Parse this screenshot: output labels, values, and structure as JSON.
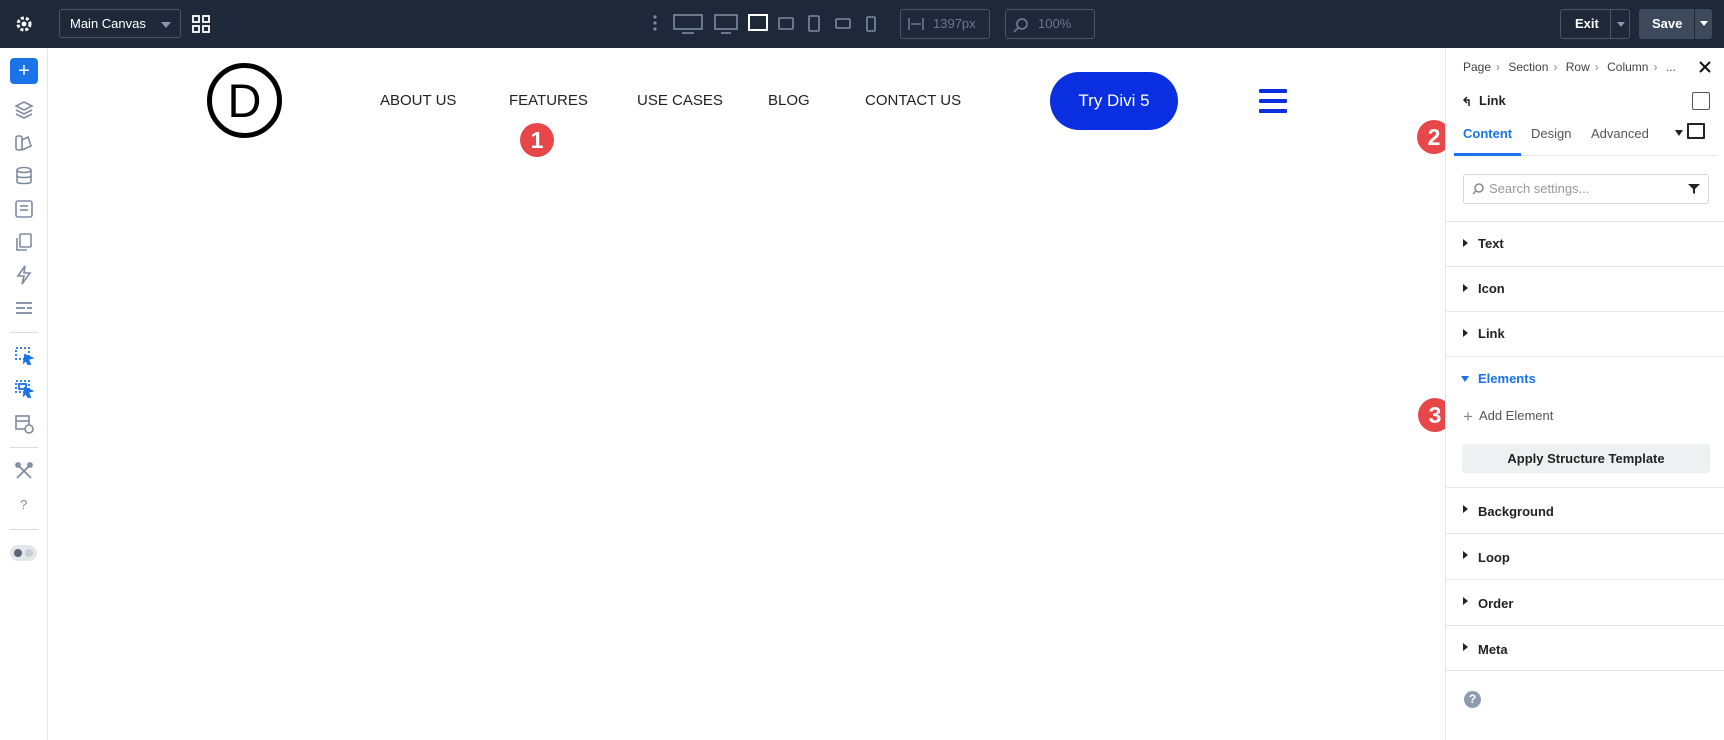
{
  "topbar": {
    "canvas_select": "Main Canvas",
    "width_value": "1397px",
    "zoom_value": "100%",
    "exit_label": "Exit",
    "save_label": "Save"
  },
  "canvas": {
    "logo_letter": "D",
    "nav": [
      "ABOUT US",
      "FEATURES",
      "USE CASES",
      "BLOG",
      "CONTACT US"
    ],
    "cta_label": "Try Divi 5",
    "brand_color": "#0a2fe0"
  },
  "badges": [
    "1",
    "2",
    "3"
  ],
  "panel": {
    "breadcrumb": [
      "Page",
      "Section",
      "Row",
      "Column",
      "..."
    ],
    "element_title": "Link",
    "tabs": [
      "Content",
      "Design",
      "Advanced"
    ],
    "search_placeholder": "Search settings...",
    "sections": [
      "Text",
      "Icon",
      "Link",
      "Elements",
      "Background",
      "Loop",
      "Order",
      "Meta"
    ],
    "add_element_label": "Add Element",
    "apply_template_label": "Apply Structure Template",
    "help_glyph": "?"
  },
  "colors": {
    "topbar_bg": "#1e2838",
    "accent": "#1a73e8",
    "badge": "#e8474a"
  }
}
